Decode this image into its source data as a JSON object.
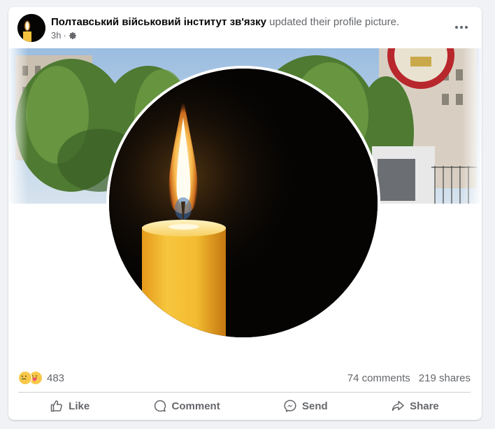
{
  "post": {
    "author": "Полтавський військовий інститут зв'язку",
    "action_text": "updated their profile picture.",
    "time": "3h",
    "separator": "·",
    "privacy_icon": "gear-icon"
  },
  "reactions": {
    "icons": [
      "sad-reaction-icon",
      "care-reaction-icon"
    ],
    "count": "483"
  },
  "stats": {
    "comments": "74 comments",
    "shares": "219 shares"
  },
  "actions": {
    "like": "Like",
    "comment": "Comment",
    "send": "Send",
    "share": "Share"
  },
  "colors": {
    "background": "#f0f2f5",
    "card": "#ffffff",
    "secondary_text": "#65676b"
  }
}
